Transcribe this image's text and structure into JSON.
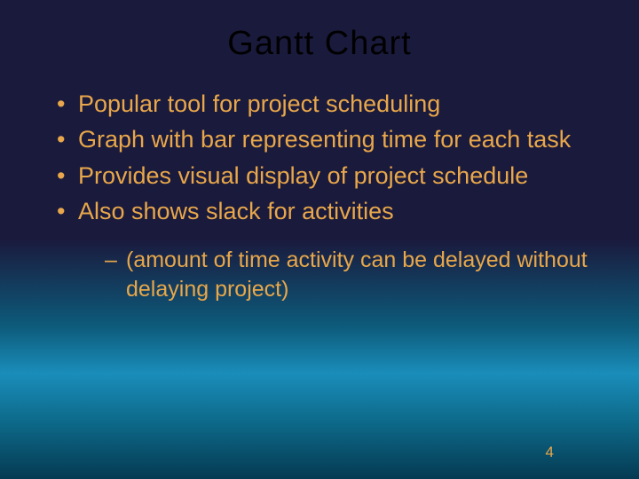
{
  "title": "Gantt Chart",
  "bullets": {
    "b1": "Popular tool for project scheduling",
    "b2": "Graph with bar representing time for each task",
    "b3": "Provides visual display of project schedule",
    "b4": "Also shows slack for activities",
    "sub1": "(amount of time activity can be delayed without delaying project)"
  },
  "page_number": "4"
}
